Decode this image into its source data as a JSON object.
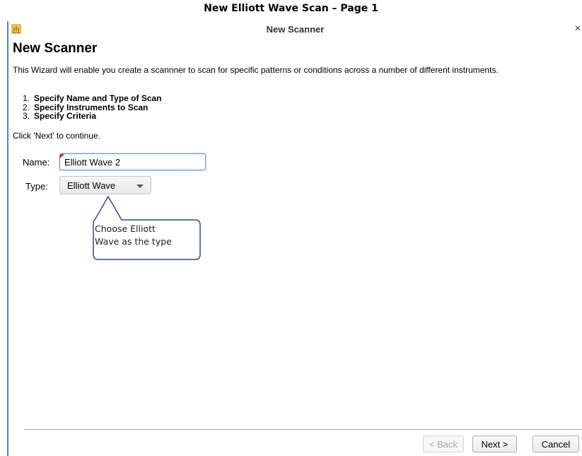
{
  "caption": "New Elliott Wave Scan – Page 1",
  "window": {
    "title": "New Scanner",
    "close_glyph": "×",
    "icon": "app-icon"
  },
  "wizard": {
    "heading": "New Scanner",
    "intro": "This Wizard will enable you create a scannner to scan for specific patterns or conditions across a number of different instruments.",
    "steps": [
      {
        "num": "1.",
        "label": "Specify Name and Type of Scan"
      },
      {
        "num": "2.",
        "label": "Specify Instruments to Scan"
      },
      {
        "num": "3.",
        "label": "Specify Criteria"
      }
    ],
    "continue_text": "Click 'Next' to continue."
  },
  "form": {
    "name_label": "Name:",
    "name_value": "Elliott Wave 2",
    "type_label": "Type:",
    "type_value": "Elliott Wave"
  },
  "callout": {
    "line1": "Choose Elliott",
    "line2": "Wave as the type"
  },
  "buttons": {
    "back": "< Back",
    "next": "Next >",
    "cancel": "Cancel"
  },
  "colors": {
    "window_border": "#3a86d8",
    "focus": "#4c9be0",
    "callout_stroke": "#2f4f7a",
    "required_flag": "#e0302a"
  }
}
